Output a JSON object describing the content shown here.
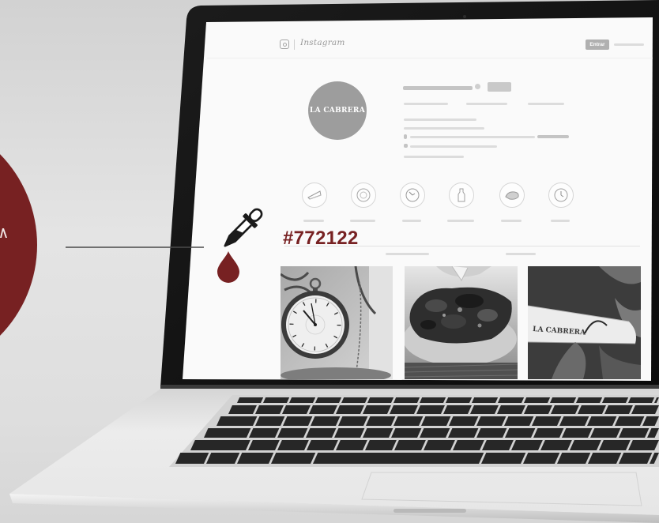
{
  "colors": {
    "swatch": "#772122",
    "background": "#dcdcdc",
    "screen": "#fafafa",
    "bezel": "#111111"
  },
  "header": {
    "logo_icon": "instagram-camera-icon",
    "logo_text": "Instagram",
    "login_button": "Entrar"
  },
  "profile": {
    "avatar_text": "LA CABRERA"
  },
  "highlights": [
    {
      "icon": "slice-icon"
    },
    {
      "icon": "plate-icon"
    },
    {
      "icon": "clock-icon"
    },
    {
      "icon": "bottle-icon"
    },
    {
      "icon": "steak-icon"
    },
    {
      "icon": "clock-icon"
    }
  ],
  "posts": {
    "third_sign": "LA CABRERA"
  },
  "swatch": {
    "hex_label": "#772122",
    "tool_icon": "eyedropper-icon"
  }
}
